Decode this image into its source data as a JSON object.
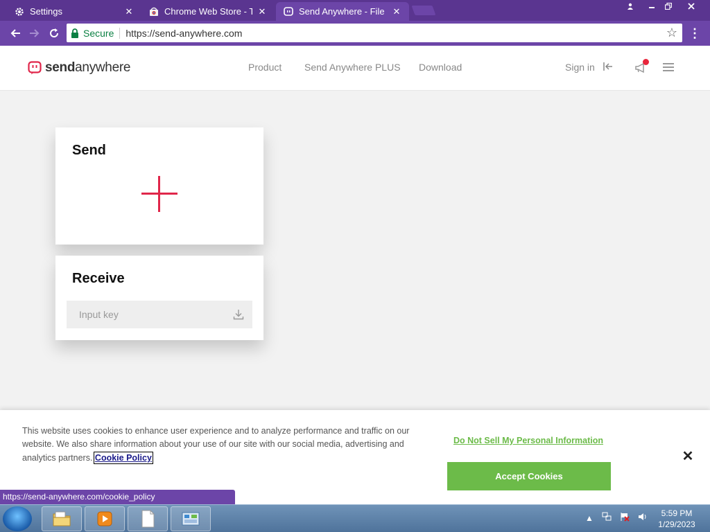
{
  "browser": {
    "tabs": [
      {
        "title": "Settings",
        "icon": "gear-icon"
      },
      {
        "title": "Chrome Web Store - The",
        "icon": "chrome-web-store-icon"
      },
      {
        "title": "Send Anywhere - File tran",
        "icon": "send-anywhere-icon",
        "active": true
      }
    ],
    "secure_label": "Secure",
    "url": "https://send-anywhere.com"
  },
  "site": {
    "logo_send": "send",
    "logo_anywhere": "anywhere",
    "nav": [
      "Product",
      "Send Anywhere PLUS",
      "Download"
    ],
    "sign_in": "Sign in",
    "brand_color": "#e0264a"
  },
  "send_card": {
    "title": "Send"
  },
  "receive_card": {
    "title": "Receive",
    "input_placeholder": "Input key"
  },
  "cookie_banner": {
    "text": "This website uses cookies to enhance user experience and to analyze performance and traffic on our website. We also share information about your use of our site with our social media, advertising and analytics partners.",
    "policy_link": "Cookie Policy",
    "do_not_sell": "Do Not Sell My Personal Information",
    "accept": "Accept Cookies",
    "accent_color": "#6cbb49"
  },
  "status_bar": {
    "text": "https://send-anywhere.com/cookie_policy"
  },
  "taskbar": {
    "time": "5:59 PM",
    "date": "1/29/2023"
  },
  "theme": {
    "chrome_frame": "#5a3590",
    "chrome_toolbar": "#6c45a8"
  }
}
